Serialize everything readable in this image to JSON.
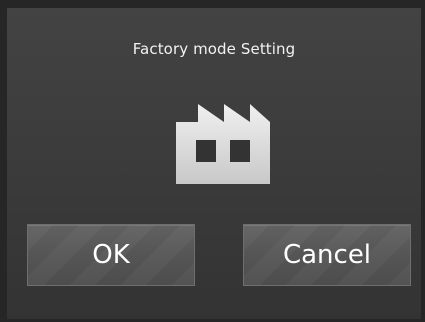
{
  "dialog": {
    "title": "Factory mode Setting",
    "icon": "factory-icon"
  },
  "buttons": {
    "ok_label": "OK",
    "cancel_label": "Cancel"
  },
  "colors": {
    "background": "#3c3c3c",
    "button": "#555555",
    "text": "#ffffff",
    "icon": "#e6e6e6"
  }
}
